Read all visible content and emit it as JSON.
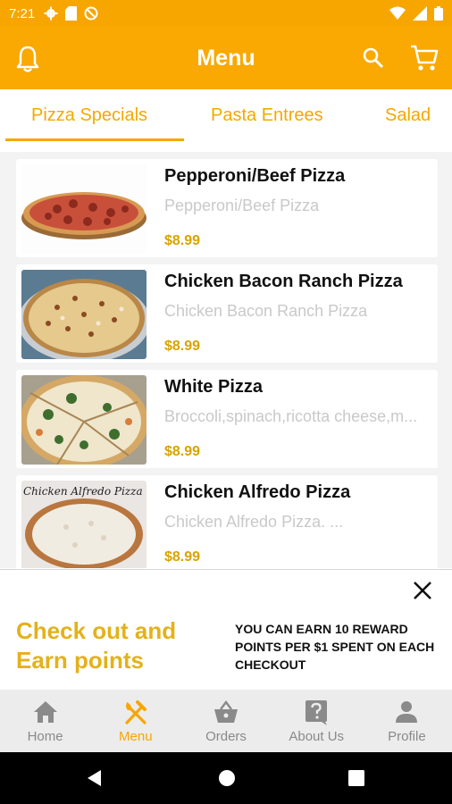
{
  "status_bar": {
    "time": "7:21"
  },
  "app_bar": {
    "title": "Menu"
  },
  "tabs": [
    {
      "label": "Pizza Specials"
    },
    {
      "label": "Pasta Entrees"
    },
    {
      "label": "Salad"
    }
  ],
  "menu_items": [
    {
      "name": "Pepperoni/Beef Pizza",
      "description": "Pepperoni/Beef Pizza",
      "price": "$8.99"
    },
    {
      "name": "Chicken Bacon Ranch Pizza",
      "description": "Chicken Bacon Ranch Pizza",
      "price": "$8.99"
    },
    {
      "name": "White Pizza",
      "description": "Broccoli,spinach,ricotta cheese,m...",
      "price": "$8.99"
    },
    {
      "name": "Chicken Alfredo Pizza",
      "description": "Chicken Alfredo Pizza. ...",
      "price": "$8.99",
      "image_caption": "Chicken Alfredo Pizza"
    }
  ],
  "promo": {
    "headline_line1": "Check out and",
    "headline_line2": "Earn points",
    "text": "YOU CAN EARN 10 REWARD POINTS PER $1 SPENT ON EACH CHECKOUT"
  },
  "bottom_nav": [
    {
      "label": "Home",
      "icon": "home-icon"
    },
    {
      "label": "Menu",
      "icon": "fork-knife-icon",
      "active": true
    },
    {
      "label": "Orders",
      "icon": "basket-icon"
    },
    {
      "label": "About Us",
      "icon": "question-icon"
    },
    {
      "label": "Profile",
      "icon": "person-icon"
    }
  ],
  "colors": {
    "accent": "#f9a901",
    "price": "#d9a300",
    "promo_headline": "#e3b21b",
    "nav_inactive": "#8a8a8a"
  }
}
